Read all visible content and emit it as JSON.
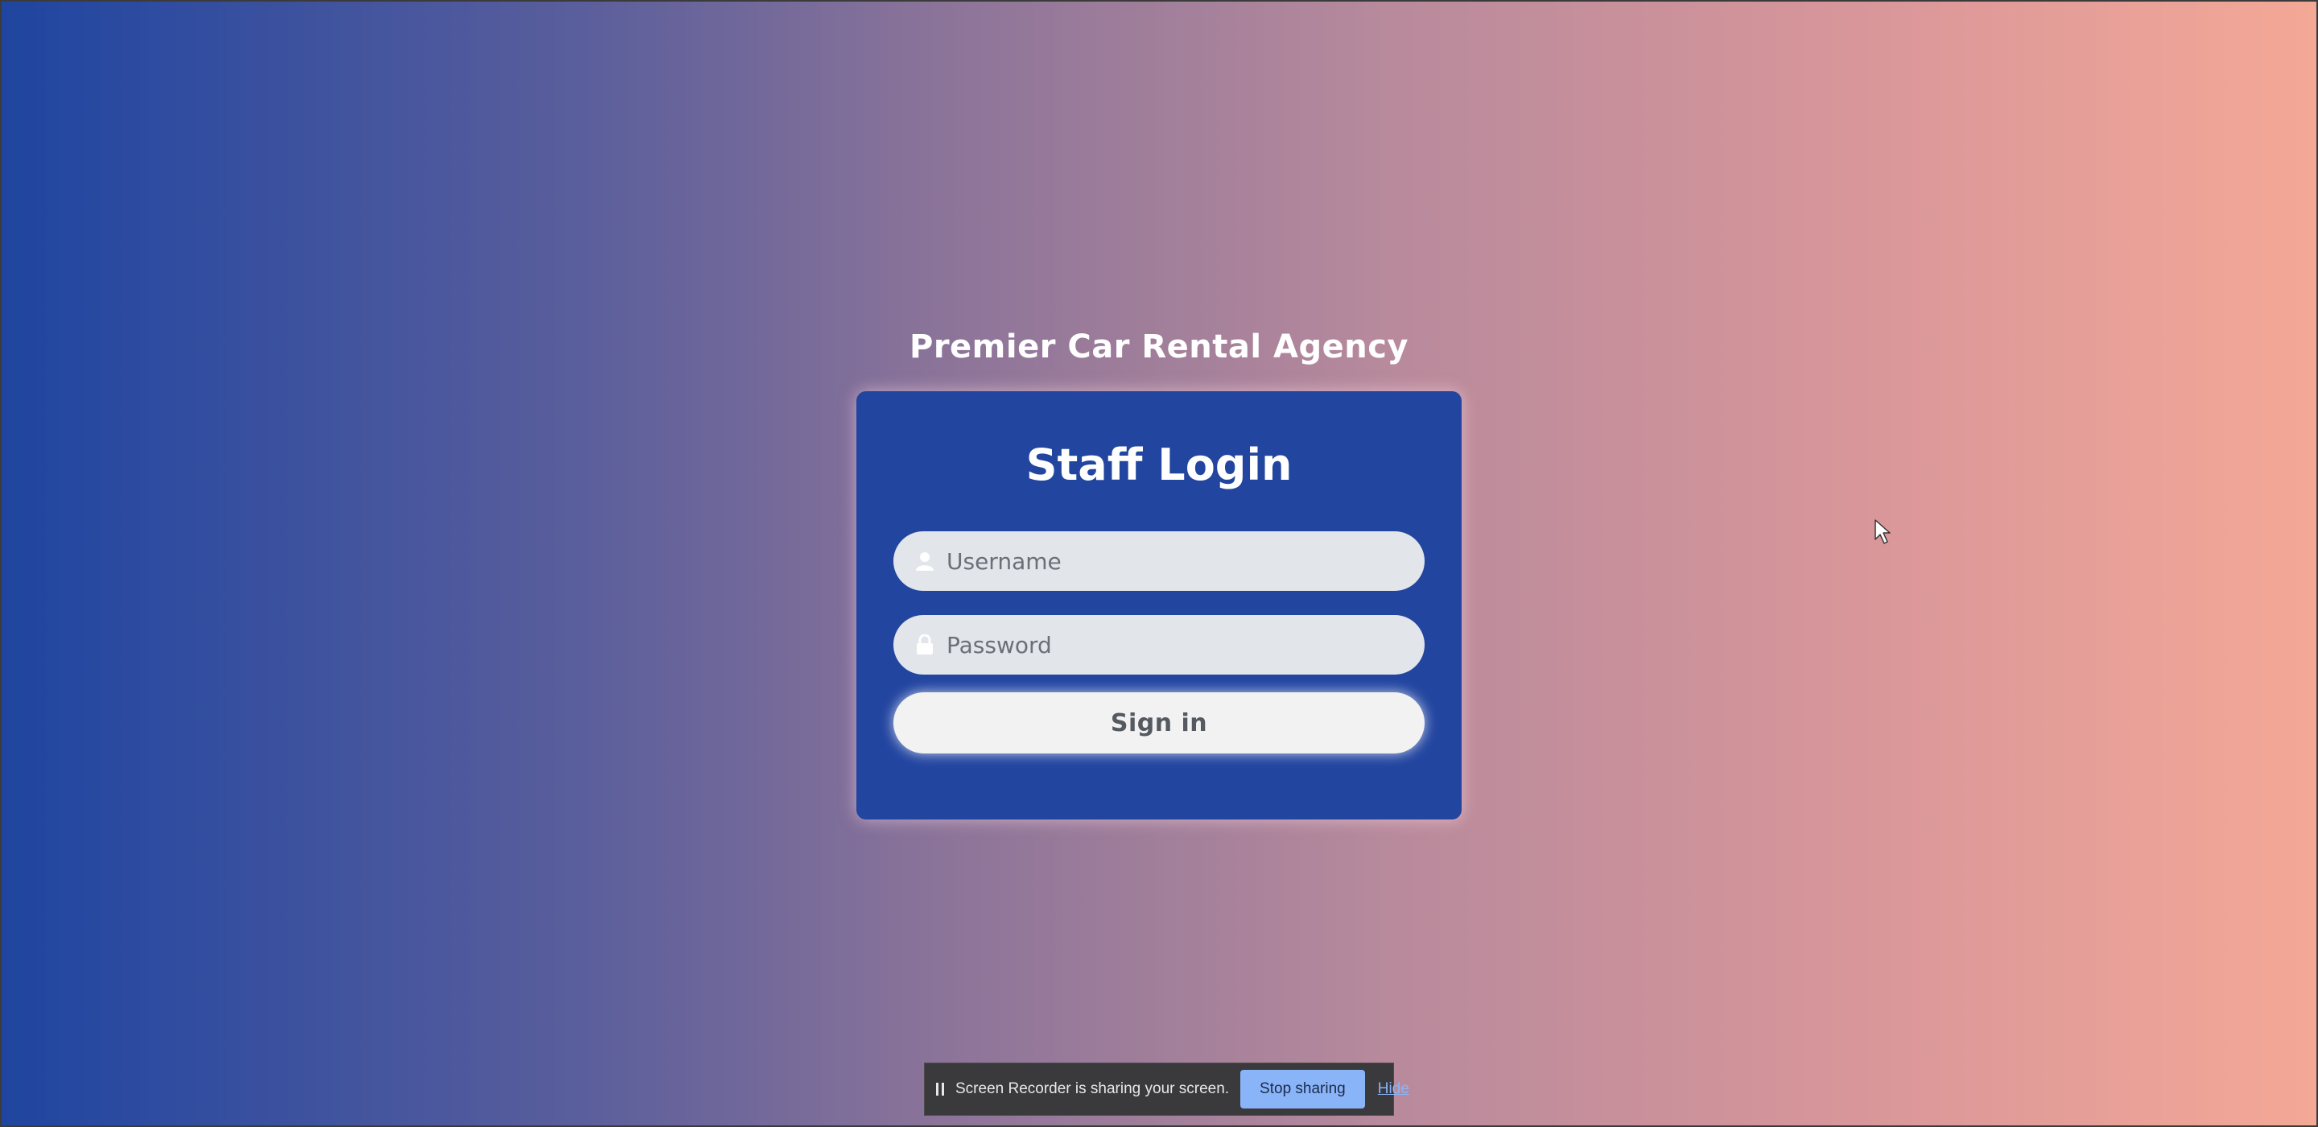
{
  "app": {
    "title": "Premier Car Rental Agency"
  },
  "login": {
    "heading": "Staff Login",
    "username_placeholder": "Username",
    "password_placeholder": "Password",
    "signin_label": "Sign in"
  },
  "share_bar": {
    "message": "Screen Recorder is sharing your screen.",
    "stop_label": "Stop sharing",
    "hide_label": "Hide"
  },
  "icons": {
    "username": "user-icon",
    "password": "lock-icon",
    "pause": "pause-icon",
    "cursor": "mouse-pointer-icon"
  },
  "colors": {
    "card": "#2245a0",
    "gradient_left": "#1f45a0",
    "gradient_right": "#f4a896",
    "field_bg": "#e2e5ea",
    "button_bg": "#f2f2f2",
    "stop_button": "#8ab4f8"
  }
}
